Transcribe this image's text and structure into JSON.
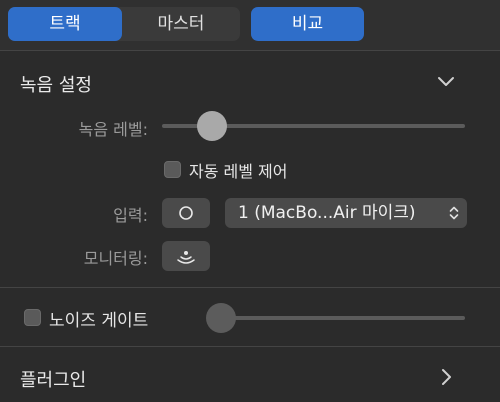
{
  "tabs": {
    "track": "트랙",
    "master": "마스터",
    "compare": "비교"
  },
  "recording_settings": {
    "title": "녹음 설정",
    "level_label": "녹음 레벨:",
    "level_value": 0.14,
    "auto_level_label": "자동 레벨 제어",
    "auto_level_checked": false,
    "input_label": "입력:",
    "input_selected": "1  (MacBo...Air 마이크)",
    "monitoring_label": "모니터링:"
  },
  "noise_gate": {
    "label": "노이즈 게이트",
    "checked": false,
    "value": 0.0
  },
  "plugins": {
    "title": "플러그인"
  },
  "colors": {
    "accent": "#2f6ec9",
    "background": "#2b2b2b"
  },
  "icons": [
    "chevron-down-icon",
    "circle-icon",
    "monitoring-icon",
    "updown-arrows-icon",
    "chevron-right-icon"
  ]
}
